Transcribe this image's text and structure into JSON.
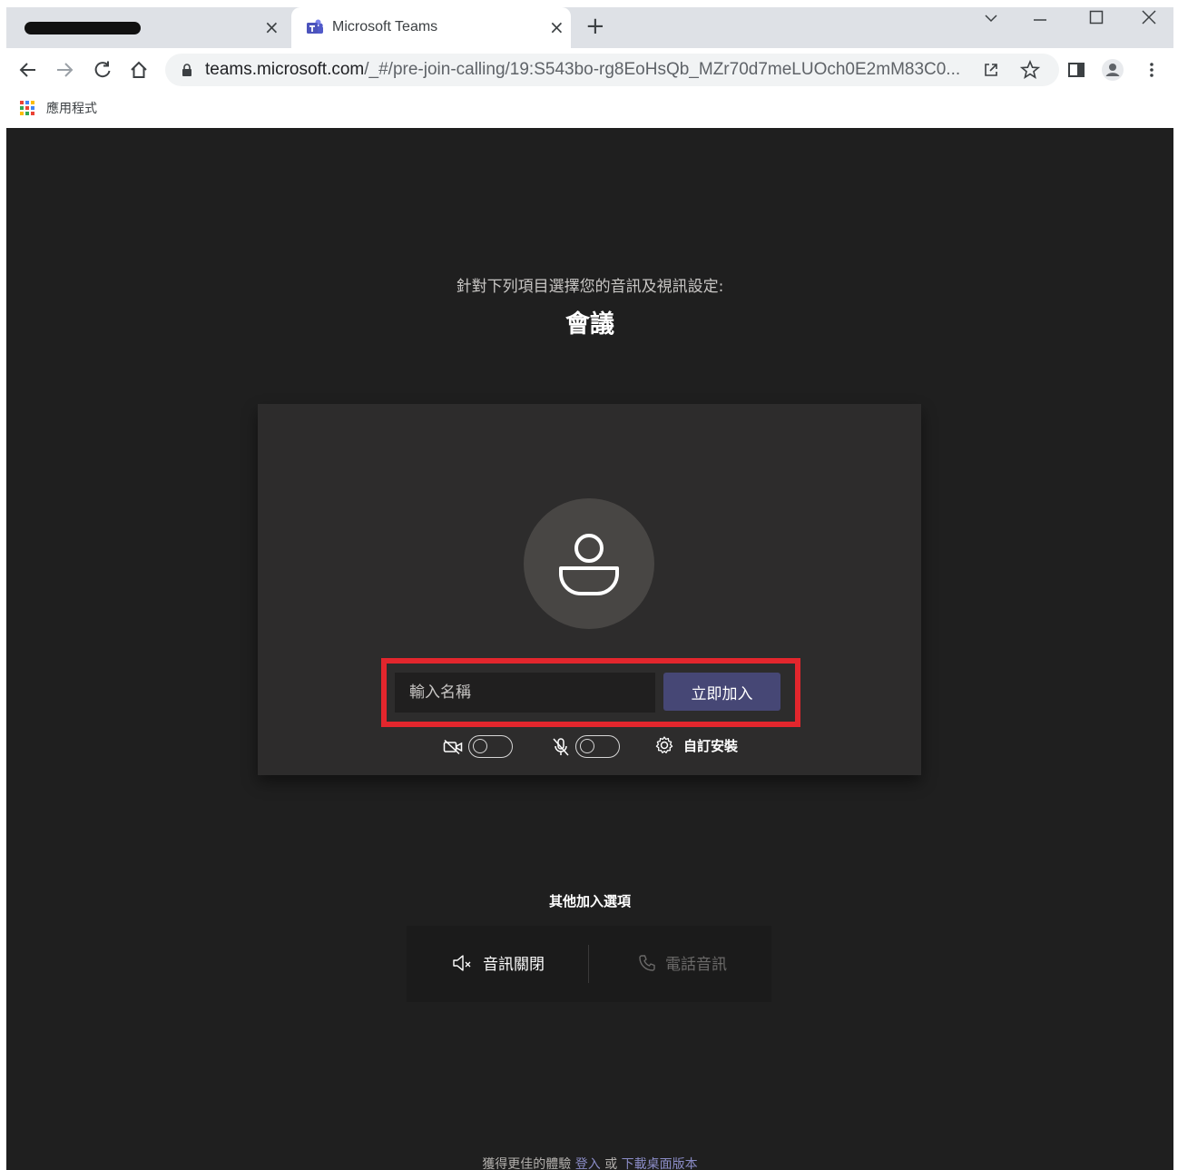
{
  "browser": {
    "tabs": [
      {
        "title": ""
      },
      {
        "title": "Microsoft Teams"
      }
    ],
    "tab_close_glyph": "×",
    "new_tab_glyph": "+",
    "url_host": "teams.microsoft.com",
    "url_path": "/_#/pre-join-calling/19:S543bo-rg8EoHsQb_MZr70d7meLUOch0E2mM83C0...",
    "bookmarks": [
      {
        "label": "應用程式",
        "icon": "apps-grid-icon"
      }
    ]
  },
  "prejoin": {
    "subtitle": "針對下列項目選擇您的音訊及視訊設定:",
    "meeting_title": "會議",
    "name_placeholder": "輸入名稱",
    "join_button": "立即加入",
    "custom_setup": "自訂安裝",
    "camera_on": false,
    "mic_on": false
  },
  "other_options": {
    "title": "其他加入選項",
    "audio_off": "音訊關閉",
    "phone_audio": "電話音訊"
  },
  "footer": {
    "prefix": "獲得更佳的體驗",
    "sign_in": "登入",
    "or": "或",
    "download": "下載桌面版本"
  },
  "colors": {
    "page_bg": "#1f1f1f",
    "card_bg": "#2d2c2c",
    "brand": "#464775",
    "highlight": "#e3262d",
    "link": "#8b8cc7"
  }
}
